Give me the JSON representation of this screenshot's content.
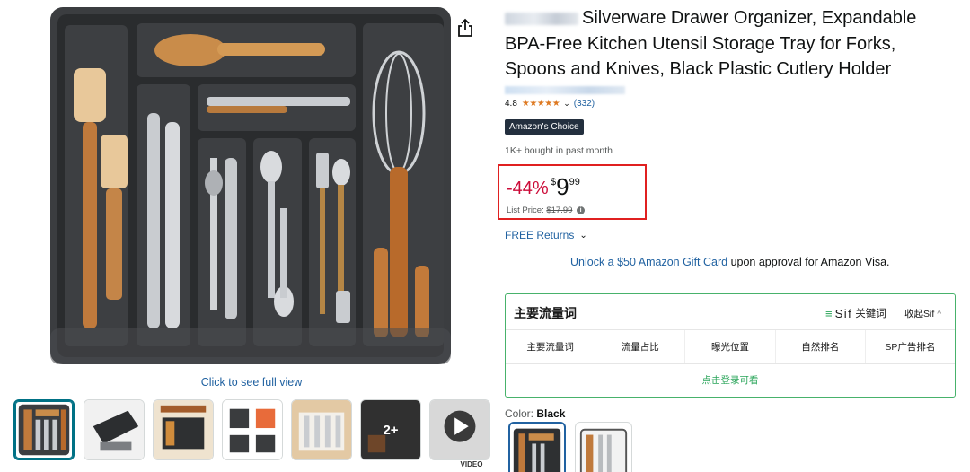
{
  "product": {
    "title": "Silverware Drawer Organizer, Expandable BPA-Free Kitchen Utensil Storage Tray for Forks, Spoons and Knives, Black Plastic Cutlery Holder",
    "rating": "4.8",
    "stars": "★★★★★",
    "review_count": "(332)",
    "badge": "Amazon's Choice",
    "bought": "1K+ bought in past month"
  },
  "price": {
    "discount": "-44%",
    "currency": "$",
    "whole": "9",
    "fraction": "99",
    "list_label": "List Price:",
    "list_value": "$17.99",
    "info_icon": "i"
  },
  "returns": {
    "label": "FREE Returns"
  },
  "promo": {
    "link": "Unlock a $50 Amazon Gift Card",
    "text": " upon approval for Amazon Visa."
  },
  "gallery": {
    "full_view": "Click to see full view",
    "more_count": "2+",
    "video_label": "VIDEO",
    "share_icon": "share-icon"
  },
  "keyword_panel": {
    "title": "主要流量词",
    "sif_label": "Sif",
    "sif_suffix": "关键词",
    "menu_icon": "≡",
    "collapse_label": "收起Sif",
    "collapse_icon": "^",
    "columns": [
      "主要流量词",
      "流量占比",
      "曝光位置",
      "自然排名",
      "SP广告排名"
    ],
    "login_text": "点击登录可看"
  },
  "color": {
    "label": "Color:",
    "value": "Black"
  },
  "colors": {
    "accent_link": "#2162a1",
    "discount_red": "#cc0c39",
    "highlight_box": "#e02020",
    "panel_green": "#47b26b",
    "star_orange": "#de7921"
  }
}
